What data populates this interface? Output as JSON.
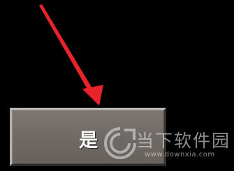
{
  "dialog": {
    "yes_button_label": "是"
  },
  "annotation": {
    "arrow_color": "#e8242a",
    "arrow_icon": "red-pointer-arrow"
  },
  "watermark": {
    "brand": "当下软件园",
    "url": "www.downxia.com",
    "logo_icon": "downxia-logo"
  },
  "colors": {
    "background": "#000000",
    "button_face": "#736e69",
    "button_text": "#ffffff"
  }
}
